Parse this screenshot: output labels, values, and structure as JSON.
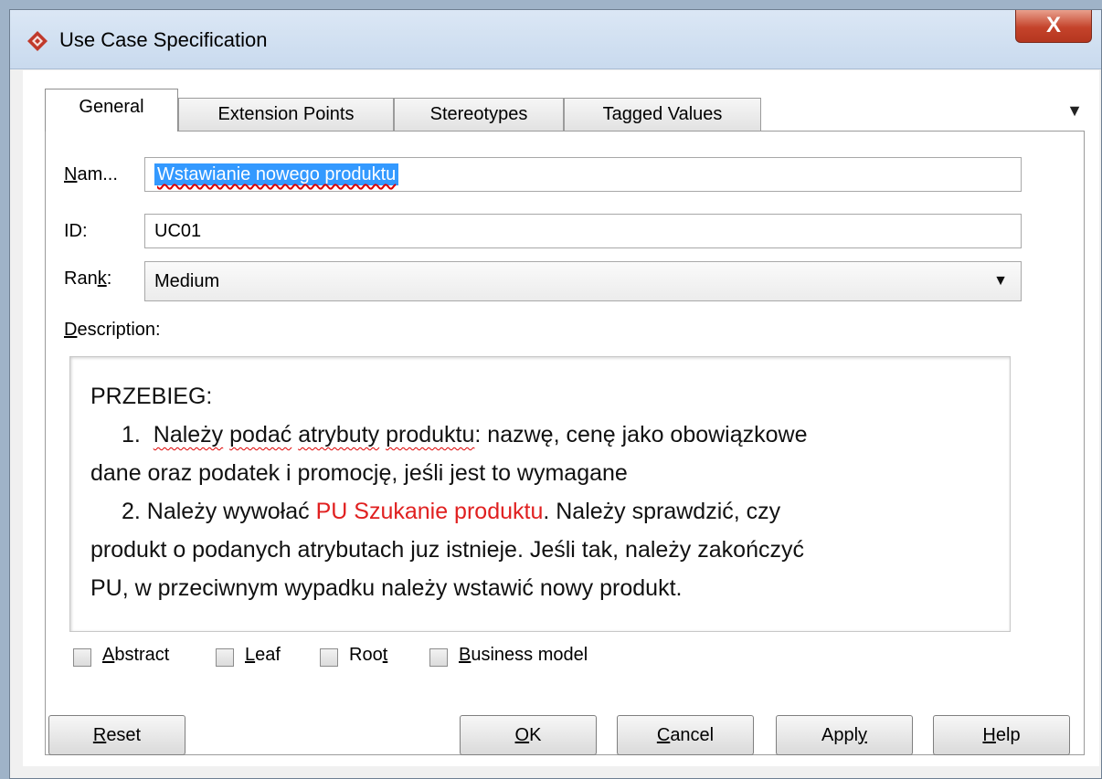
{
  "window": {
    "title": "Use Case Specification",
    "close_label": "X"
  },
  "tabs": [
    {
      "label": "General"
    },
    {
      "label": "Extension Points"
    },
    {
      "label": "Stereotypes"
    },
    {
      "label": "Tagged Values"
    }
  ],
  "tab_menu_icon": "▼",
  "form": {
    "name_label_prefix": "N",
    "name_label_rest": "am...",
    "name_value": "Wstawianie nowego produktu",
    "id_label": "ID:",
    "id_value": "UC01",
    "rank_label_prefix": "Ran",
    "rank_label_mnemonic": "k",
    "rank_label_suffix": ":",
    "rank_value": "Medium",
    "description_label_mnemonic": "D",
    "description_label_rest": "escription:"
  },
  "description": {
    "heading": "PRZEBIEG:",
    "step1": {
      "num": "1.",
      "parts": [
        "Należy",
        "podać",
        "atrybuty",
        "produktu",
        ": nazwę, cenę jako obowiązkowe dane oraz podatek i promocję, jeśli jest to wymagane"
      ],
      "line1": "Należy podać atrybuty produktu: nazwę, cenę jako obowiązkowe",
      "line2": "dane oraz podatek i promocję, jeśli jest to wymagane"
    },
    "step2": {
      "num": "2.",
      "prefix": "2. Należy wywołać",
      "link": "PU Szukanie produktu",
      "rest_line1": ". Należy sprawdzić, czy",
      "line2": "produkt o podanych atrybutach juz istnieje. Jeśli tak, należy zakończyć",
      "line3": "PU, w przeciwnym wypadku należy wstawić nowy produkt."
    },
    "link_color": "#e02020"
  },
  "checkboxes": [
    {
      "mnemonic": "A",
      "rest": "bstract",
      "checked": false
    },
    {
      "mnemonic": "L",
      "rest": "eaf",
      "checked": false
    },
    {
      "pre": "Roo",
      "mnemonic": "t",
      "checked": false
    },
    {
      "mnemonic": "B",
      "rest": "usiness model",
      "checked": false
    }
  ],
  "buttons": {
    "reset": {
      "mnemonic": "R",
      "rest": "eset"
    },
    "ok": {
      "mnemonic": "O",
      "rest": "K"
    },
    "cancel": {
      "mnemonic": "C",
      "rest": "ancel"
    },
    "apply": {
      "pre": "Appl",
      "mnemonic": "y"
    },
    "help": {
      "mnemonic": "H",
      "rest": "elp"
    }
  },
  "colors": {
    "selection": "#3399ff",
    "close_button": "#c4432b",
    "spell_underline": "#d00"
  }
}
